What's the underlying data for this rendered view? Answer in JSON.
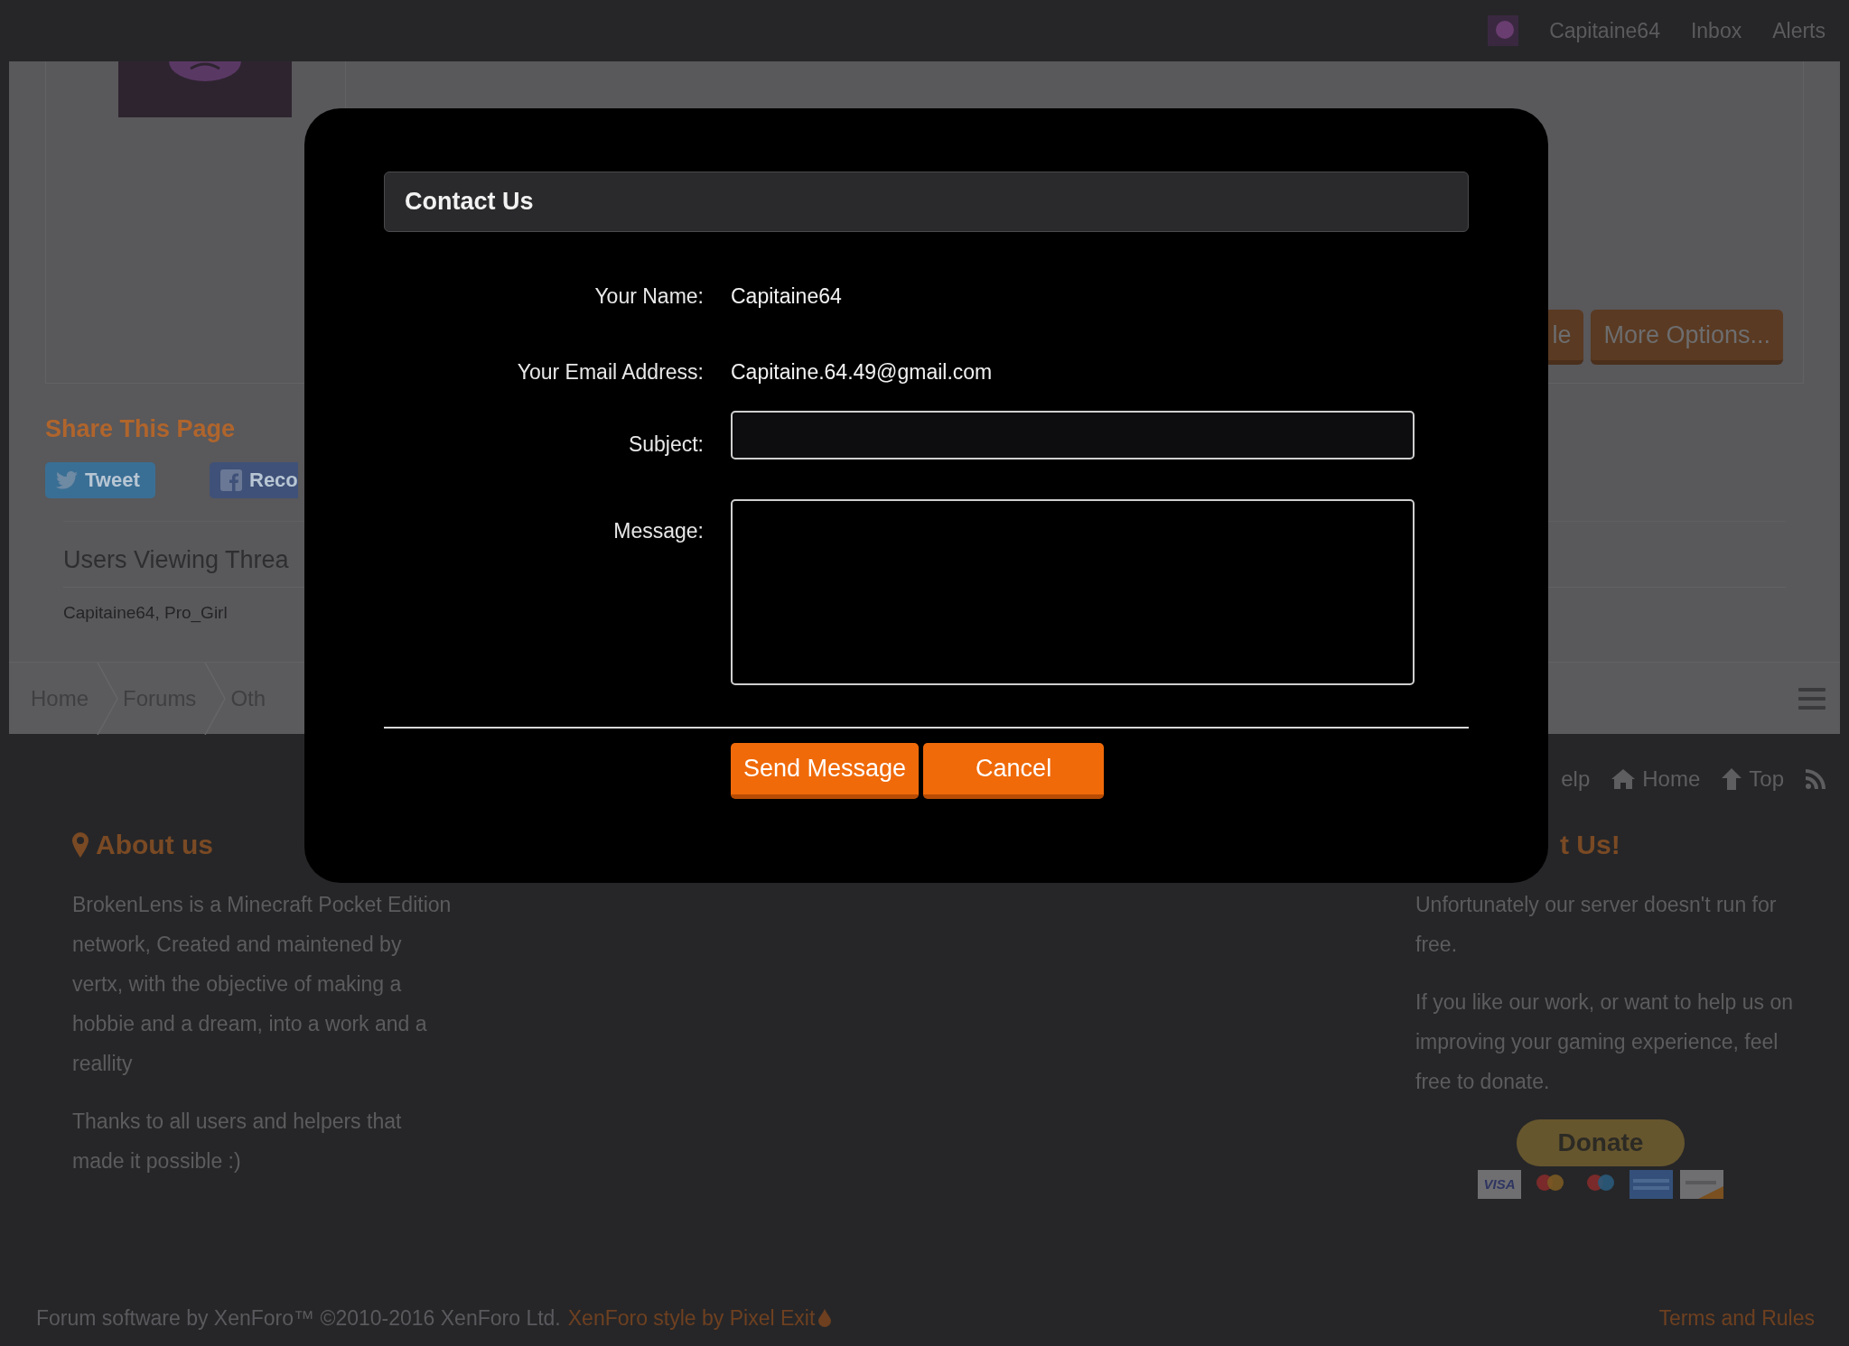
{
  "top_bar": {
    "items": [
      "Capitaine64",
      "Inbox",
      "Alerts"
    ]
  },
  "post": {
    "actions": [
      "le",
      "More Options..."
    ]
  },
  "share": {
    "title": "Share This Page",
    "buttons": [
      {
        "kind": "twitter",
        "label": "Tweet"
      },
      {
        "kind": "facebook",
        "label": "Reco"
      }
    ]
  },
  "users_viewing": {
    "title": "Users Viewing Threa",
    "names": "Capitaine64, Pro_Girl"
  },
  "breadcrumbs": [
    "Home",
    "Forums",
    "Oth"
  ],
  "footer_links": [
    {
      "kind": "text",
      "label": "elp"
    },
    {
      "kind": "home",
      "label": "Home"
    },
    {
      "kind": "top",
      "label": "Top"
    },
    {
      "kind": "rss"
    }
  ],
  "about": {
    "title": "About us",
    "paragraphs": [
      "BrokenLens is a Minecraft Pocket Edition network, Created and maintened by vertx, with the objective of making a hobbie and a dream, into a work and a reallity",
      "Thanks to all users and helpers that made it possible :)"
    ]
  },
  "support": {
    "title": "t Us!",
    "paragraphs": [
      "Unfortunately our server doesn't run for free.",
      "If you like our work, or want to help us on improving your gaming experience, feel free to donate."
    ],
    "donate": "Donate",
    "cards": [
      {
        "kind": "visa",
        "label": "VISA"
      },
      {
        "kind": "mastercard"
      },
      {
        "kind": "maestro"
      },
      {
        "kind": "amex"
      },
      {
        "kind": "discover"
      }
    ]
  },
  "bottom": {
    "copyright": "Forum software by XenForo™ ©2010-2016 XenForo Ltd.",
    "style_credit": "XenForo style by Pixel Exit",
    "terms": "Terms and Rules"
  },
  "modal": {
    "title": "Contact Us",
    "fields": [
      {
        "kind": "static",
        "label": "Your Name:",
        "value": "Capitaine64"
      },
      {
        "kind": "static",
        "label": "Your Email Address:",
        "value": "Capitaine.64.49@gmail.com"
      },
      {
        "kind": "input",
        "label": "Subject:"
      },
      {
        "kind": "textarea",
        "label": "Message:"
      }
    ],
    "buttons": [
      "Send Message",
      "Cancel"
    ]
  }
}
